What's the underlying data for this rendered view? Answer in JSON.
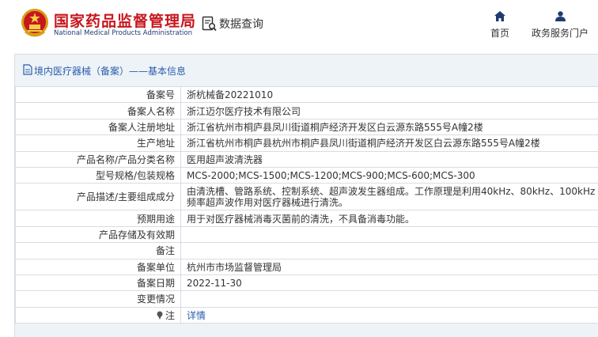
{
  "header": {
    "org_name_cn": "国家药品监督管理局",
    "org_name_en": "National Medical Products Administration",
    "query_label": "数据查询",
    "nav": [
      {
        "label": "首页",
        "icon": "home-icon"
      },
      {
        "label": "政务服务门户",
        "icon": "user-icon"
      }
    ]
  },
  "breadcrumb": {
    "text": "境内医疗器械（备案）——基本信息",
    "icon": "document-icon"
  },
  "colors": {
    "brand_red": "#c8161d",
    "link_blue": "#2a5caa",
    "panel_bg": "#eef3f8",
    "border": "#d7dde4"
  },
  "record": {
    "rows": [
      {
        "label": "备案号",
        "value": "浙杭械备20221010"
      },
      {
        "label": "备案人名称",
        "value": "浙江迈尔医疗技术有限公司"
      },
      {
        "label": "备案人注册地址",
        "value": "浙江省杭州市桐庐县凤川街道桐庐经济开发区白云源东路555号A幢2楼"
      },
      {
        "label": "生产地址",
        "value": "浙江省杭州市桐庐县杭州市桐庐县凤川街道桐庐经济开发区白云源东路555号A幢2楼"
      },
      {
        "label": "产品名称/产品分类名称",
        "value": "医用超声波清洗器"
      },
      {
        "label": "型号规格/包装规格",
        "value": "MCS-2000;MCS-1500;MCS-1200;MCS-900;MCS-600;MCS-300"
      },
      {
        "label": "产品描述/主要组成成分",
        "value": "由清洗槽、管路系统、控制系统、超声波发生器组成。工作原理是利用40kHz、80kHz、100kHz频率超声波作用对医疗器械进行清洗。"
      },
      {
        "label": "预期用途",
        "value": "用于对医疗器械消毒灭菌前的清洗，不具备消毒功能。"
      },
      {
        "label": "产品存储及有效期",
        "value": ""
      },
      {
        "label": "备注",
        "value": ""
      },
      {
        "label": "备案单位",
        "value": "杭州市市场监督管理局"
      },
      {
        "label": "备案日期",
        "value": "2022-11-30"
      },
      {
        "label": "变更情况",
        "value": ""
      },
      {
        "label": "注",
        "value": "详情"
      }
    ]
  }
}
